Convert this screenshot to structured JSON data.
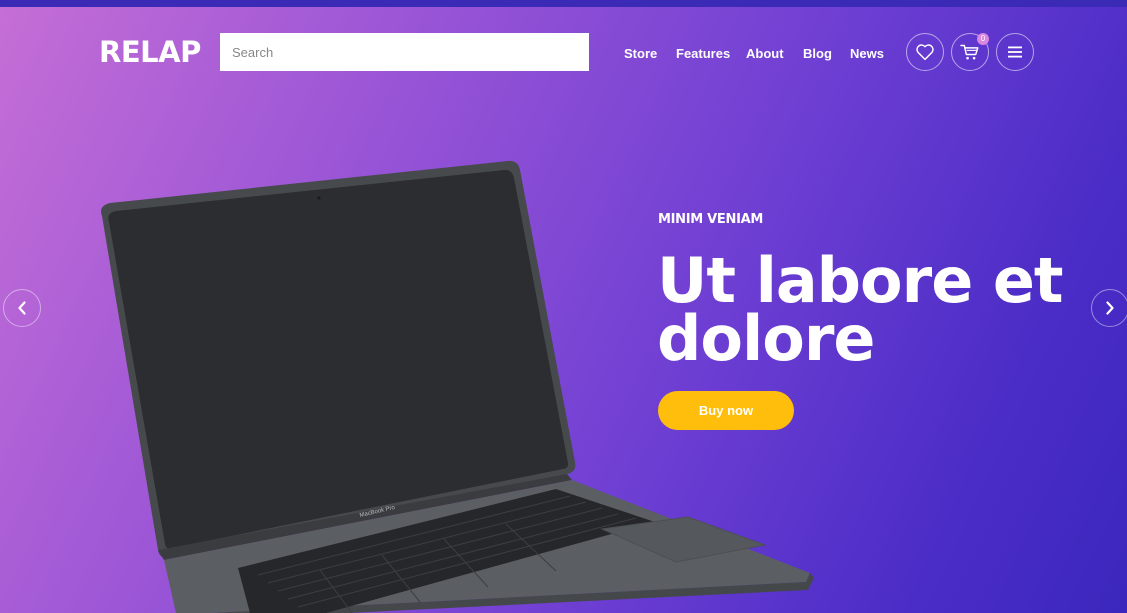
{
  "header": {
    "logo": "RELAP",
    "search": {
      "placeholder": "Search",
      "value": ""
    },
    "nav": [
      "Store",
      "Features",
      "About",
      "Blog",
      "News"
    ],
    "cart_count": "0",
    "icons": {
      "wishlist": "heart-icon",
      "cart": "cart-icon",
      "menu": "hamburger-icon"
    }
  },
  "hero": {
    "eyebrow": "MINIM VENIAM",
    "headline": "Ut labore et dolore",
    "cta": "Buy now",
    "product_label": "MacBook Pro",
    "prev": "chevron-left-icon",
    "next": "chevron-right-icon"
  },
  "colors": {
    "accent": "#ffbe0b",
    "gradient_start": "#c56ed6",
    "gradient_end": "#3b27bd",
    "top_strip": "#3a2ab5"
  }
}
